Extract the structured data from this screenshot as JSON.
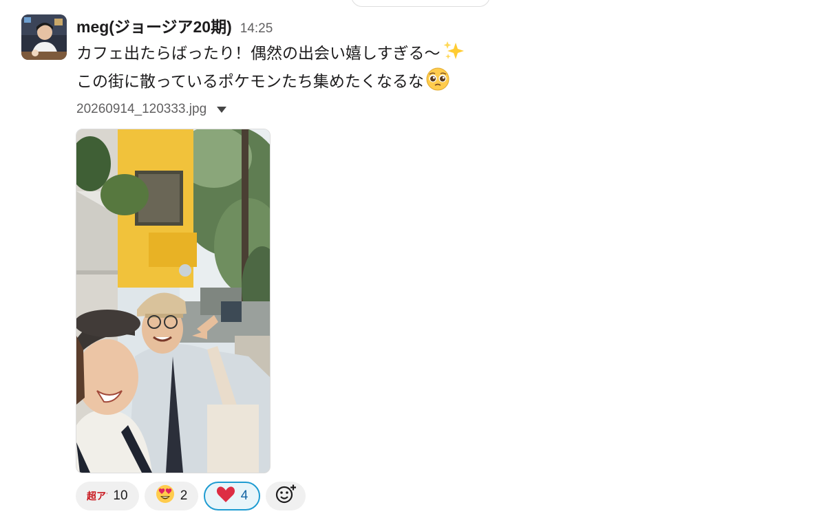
{
  "message": {
    "sender": "meg(ジョージア20期)",
    "time": "14:25",
    "line1": "カフェ出たらばったり！偶然の出会い嬉しすぎる〜",
    "line2": "この街に散っているポケモンたち集めたくなるな",
    "line1_emoji": "sparkles-icon",
    "line2_emoji": "pleading-face-icon"
  },
  "attachment": {
    "file_name": "20260914_120333.jpg"
  },
  "reactions": [
    {
      "icon": "custom-text-emoji",
      "emoji_text": "超アツ",
      "count": "10",
      "active": false
    },
    {
      "icon": "heart-eyes-emoji",
      "count": "2",
      "active": false
    },
    {
      "icon": "red-heart-emoji",
      "count": "4",
      "active": true
    }
  ],
  "colors": {
    "accent_blue": "#1d9bd1",
    "reaction_bg": "#f0f0f0",
    "text": "#1d1c1d",
    "muted": "#616061"
  }
}
